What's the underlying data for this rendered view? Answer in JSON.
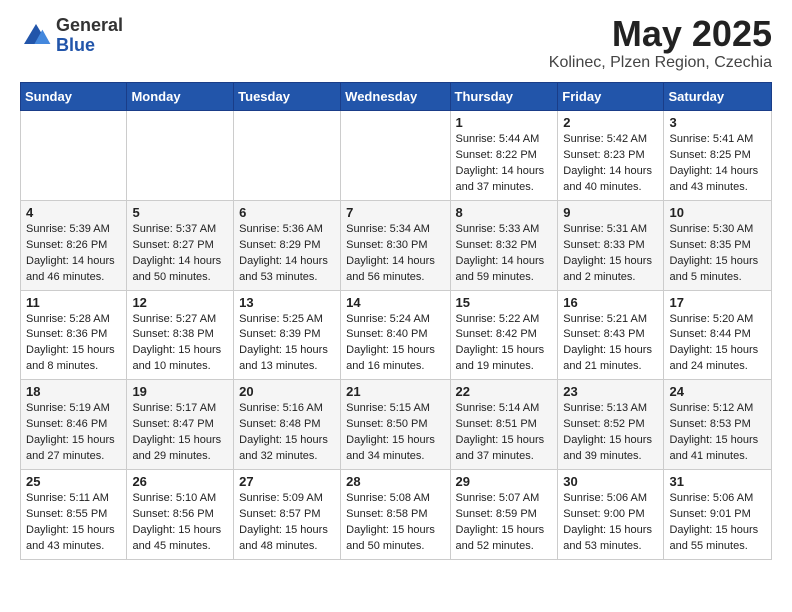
{
  "logo": {
    "general": "General",
    "blue": "Blue"
  },
  "title": "May 2025",
  "location": "Kolinec, Plzen Region, Czechia",
  "weekdays": [
    "Sunday",
    "Monday",
    "Tuesday",
    "Wednesday",
    "Thursday",
    "Friday",
    "Saturday"
  ],
  "weeks": [
    [
      {
        "day": "",
        "info": ""
      },
      {
        "day": "",
        "info": ""
      },
      {
        "day": "",
        "info": ""
      },
      {
        "day": "",
        "info": ""
      },
      {
        "day": "1",
        "info": "Sunrise: 5:44 AM\nSunset: 8:22 PM\nDaylight: 14 hours and 37 minutes."
      },
      {
        "day": "2",
        "info": "Sunrise: 5:42 AM\nSunset: 8:23 PM\nDaylight: 14 hours and 40 minutes."
      },
      {
        "day": "3",
        "info": "Sunrise: 5:41 AM\nSunset: 8:25 PM\nDaylight: 14 hours and 43 minutes."
      }
    ],
    [
      {
        "day": "4",
        "info": "Sunrise: 5:39 AM\nSunset: 8:26 PM\nDaylight: 14 hours and 46 minutes."
      },
      {
        "day": "5",
        "info": "Sunrise: 5:37 AM\nSunset: 8:27 PM\nDaylight: 14 hours and 50 minutes."
      },
      {
        "day": "6",
        "info": "Sunrise: 5:36 AM\nSunset: 8:29 PM\nDaylight: 14 hours and 53 minutes."
      },
      {
        "day": "7",
        "info": "Sunrise: 5:34 AM\nSunset: 8:30 PM\nDaylight: 14 hours and 56 minutes."
      },
      {
        "day": "8",
        "info": "Sunrise: 5:33 AM\nSunset: 8:32 PM\nDaylight: 14 hours and 59 minutes."
      },
      {
        "day": "9",
        "info": "Sunrise: 5:31 AM\nSunset: 8:33 PM\nDaylight: 15 hours and 2 minutes."
      },
      {
        "day": "10",
        "info": "Sunrise: 5:30 AM\nSunset: 8:35 PM\nDaylight: 15 hours and 5 minutes."
      }
    ],
    [
      {
        "day": "11",
        "info": "Sunrise: 5:28 AM\nSunset: 8:36 PM\nDaylight: 15 hours and 8 minutes."
      },
      {
        "day": "12",
        "info": "Sunrise: 5:27 AM\nSunset: 8:38 PM\nDaylight: 15 hours and 10 minutes."
      },
      {
        "day": "13",
        "info": "Sunrise: 5:25 AM\nSunset: 8:39 PM\nDaylight: 15 hours and 13 minutes."
      },
      {
        "day": "14",
        "info": "Sunrise: 5:24 AM\nSunset: 8:40 PM\nDaylight: 15 hours and 16 minutes."
      },
      {
        "day": "15",
        "info": "Sunrise: 5:22 AM\nSunset: 8:42 PM\nDaylight: 15 hours and 19 minutes."
      },
      {
        "day": "16",
        "info": "Sunrise: 5:21 AM\nSunset: 8:43 PM\nDaylight: 15 hours and 21 minutes."
      },
      {
        "day": "17",
        "info": "Sunrise: 5:20 AM\nSunset: 8:44 PM\nDaylight: 15 hours and 24 minutes."
      }
    ],
    [
      {
        "day": "18",
        "info": "Sunrise: 5:19 AM\nSunset: 8:46 PM\nDaylight: 15 hours and 27 minutes."
      },
      {
        "day": "19",
        "info": "Sunrise: 5:17 AM\nSunset: 8:47 PM\nDaylight: 15 hours and 29 minutes."
      },
      {
        "day": "20",
        "info": "Sunrise: 5:16 AM\nSunset: 8:48 PM\nDaylight: 15 hours and 32 minutes."
      },
      {
        "day": "21",
        "info": "Sunrise: 5:15 AM\nSunset: 8:50 PM\nDaylight: 15 hours and 34 minutes."
      },
      {
        "day": "22",
        "info": "Sunrise: 5:14 AM\nSunset: 8:51 PM\nDaylight: 15 hours and 37 minutes."
      },
      {
        "day": "23",
        "info": "Sunrise: 5:13 AM\nSunset: 8:52 PM\nDaylight: 15 hours and 39 minutes."
      },
      {
        "day": "24",
        "info": "Sunrise: 5:12 AM\nSunset: 8:53 PM\nDaylight: 15 hours and 41 minutes."
      }
    ],
    [
      {
        "day": "25",
        "info": "Sunrise: 5:11 AM\nSunset: 8:55 PM\nDaylight: 15 hours and 43 minutes."
      },
      {
        "day": "26",
        "info": "Sunrise: 5:10 AM\nSunset: 8:56 PM\nDaylight: 15 hours and 45 minutes."
      },
      {
        "day": "27",
        "info": "Sunrise: 5:09 AM\nSunset: 8:57 PM\nDaylight: 15 hours and 48 minutes."
      },
      {
        "day": "28",
        "info": "Sunrise: 5:08 AM\nSunset: 8:58 PM\nDaylight: 15 hours and 50 minutes."
      },
      {
        "day": "29",
        "info": "Sunrise: 5:07 AM\nSunset: 8:59 PM\nDaylight: 15 hours and 52 minutes."
      },
      {
        "day": "30",
        "info": "Sunrise: 5:06 AM\nSunset: 9:00 PM\nDaylight: 15 hours and 53 minutes."
      },
      {
        "day": "31",
        "info": "Sunrise: 5:06 AM\nSunset: 9:01 PM\nDaylight: 15 hours and 55 minutes."
      }
    ]
  ]
}
